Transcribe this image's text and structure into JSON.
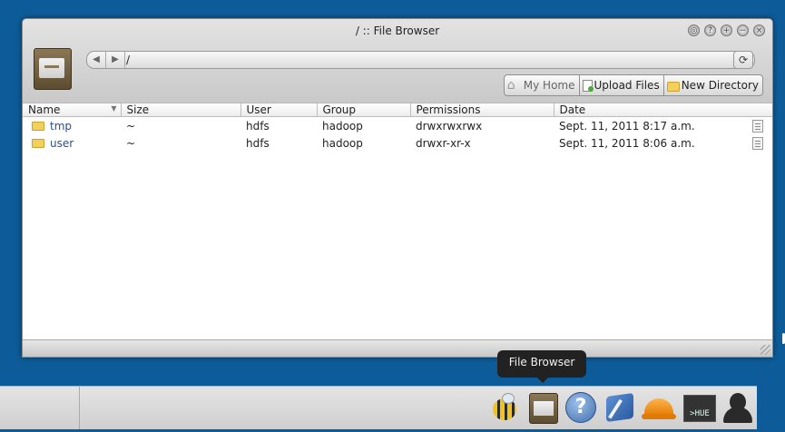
{
  "window": {
    "title": "/ :: File Browser",
    "controls": [
      "◎",
      "?",
      "+",
      "−",
      "×"
    ]
  },
  "path": {
    "back_label": "◀",
    "forward_label": "▶",
    "current": "/",
    "dropdown": "▼",
    "refresh": "⟳"
  },
  "toolbar": {
    "home_label": "My Home",
    "upload_label": "Upload Files",
    "newdir_label": "New Directory"
  },
  "table": {
    "columns": [
      "Name",
      "Size",
      "User",
      "Group",
      "Permissions",
      "Date"
    ],
    "rows": [
      {
        "name": "tmp",
        "size": "~",
        "user": "hdfs",
        "group": "hadoop",
        "permissions": "drwxrwxrwx",
        "date": "Sept. 11, 2011 8:17 a.m."
      },
      {
        "name": "user",
        "size": "~",
        "user": "hdfs",
        "group": "hadoop",
        "permissions": "drwxr-xr-x",
        "date": "Sept. 11, 2011 8:06 a.m."
      }
    ]
  },
  "tooltip": {
    "text": "File Browser"
  },
  "dock": {
    "shell_label": ">HUE"
  },
  "colors": {
    "desktop": "#0d5c99",
    "link": "#2b4f8c",
    "folder": "#f3cf5c"
  }
}
